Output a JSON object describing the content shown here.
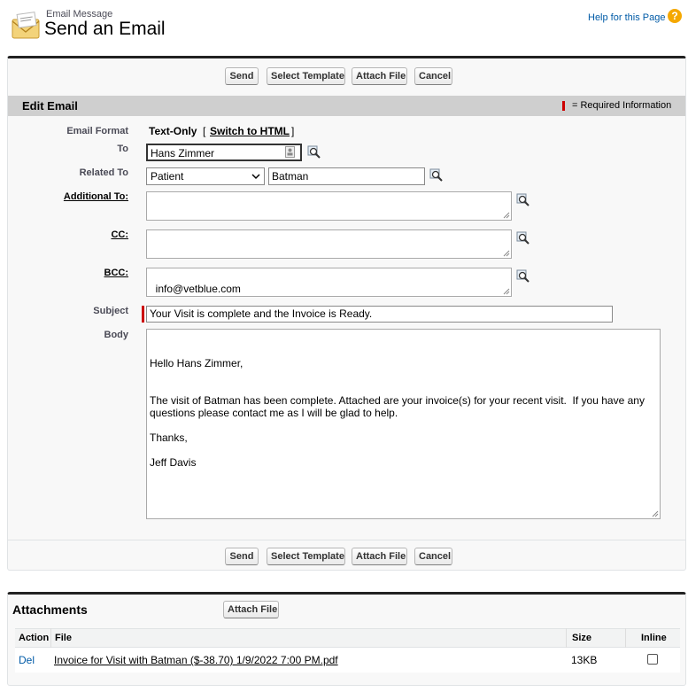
{
  "header": {
    "subtitle": "Email Message",
    "title": "Send an Email",
    "help_link": "Help for this Page",
    "help_icon": "?"
  },
  "toolbar": {
    "send": "Send",
    "select_template": "Select Template",
    "attach_file": "Attach File",
    "cancel": "Cancel"
  },
  "section": {
    "title": "Edit Email",
    "required_info": "= Required Information"
  },
  "form": {
    "email_format_label": "Email Format",
    "email_format_value": "Text-Only",
    "switch_open": "[",
    "switch_link": "Switch to HTML",
    "switch_close": "]",
    "to_label": "To",
    "to_value": "Hans Zimmer",
    "related_to_label": "Related To",
    "related_to_type": "Patient",
    "related_to_value": "Batman",
    "additional_to_label": "Additional To:",
    "additional_to_value": "",
    "cc_label": "CC:",
    "cc_value": "",
    "bcc_label": "BCC:",
    "bcc_value": "info@vetblue.com",
    "subject_label": "Subject",
    "subject_value": "Your Visit is complete and the Invoice is Ready.",
    "body_label": "Body",
    "body_value": "Hello Hans Zimmer,\n\n\nThe visit of Batman has been complete. Attached are your invoice(s) for your recent visit.  If you have any\nquestions please contact me as I will be glad to help.\n\nThanks,\n\nJeff Davis"
  },
  "attachments": {
    "title": "Attachments",
    "attach_button": "Attach File",
    "columns": [
      "Action",
      "File",
      "Size",
      "Inline"
    ],
    "rows": [
      {
        "action": "Del",
        "file": "Invoice for Visit with Batman ($-38.70) 1/9/2022 7:00 PM.pdf",
        "size": "13KB",
        "inline": false
      }
    ]
  },
  "colors": {
    "link": "#015ba7",
    "required": "#cc0000",
    "section_bar": "#cfcfcf",
    "help_icon": "#f5a800"
  }
}
